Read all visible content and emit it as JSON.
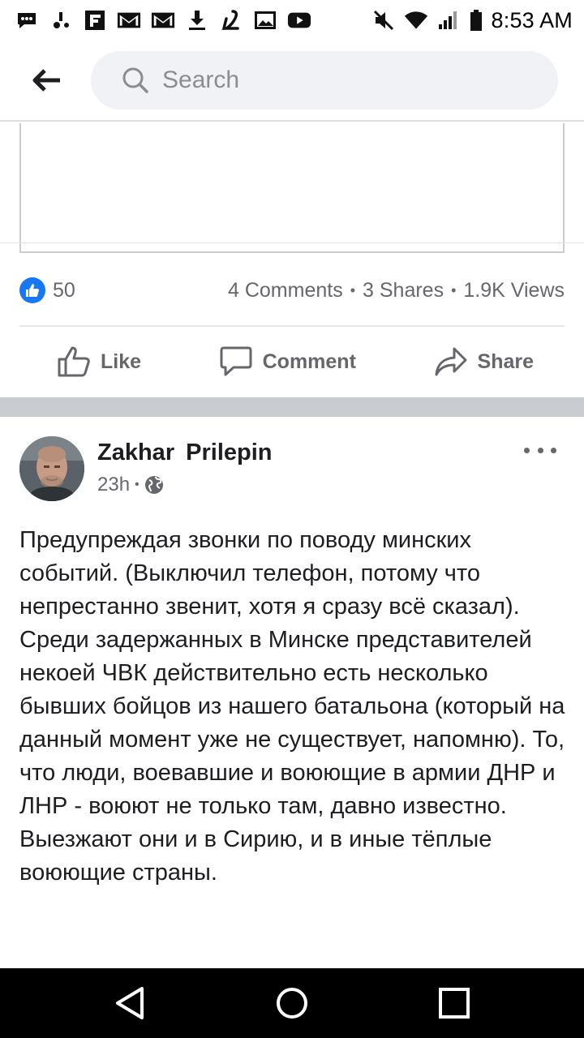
{
  "status_bar": {
    "time": "8:53 AM",
    "icons": [
      "messenger-icon",
      "voicemail-icon",
      "flipboard-icon",
      "gmail-icon",
      "gmail-icon",
      "download-icon",
      "lyft-icon",
      "image-icon",
      "youtube-icon",
      "mute-icon",
      "wifi-icon",
      "signal-icon",
      "battery-icon"
    ]
  },
  "search": {
    "placeholder": "Search"
  },
  "previous_post": {
    "like_count": "50",
    "comments": "4 Comments",
    "shares": "3 Shares",
    "views": "1.9K Views",
    "separator": "•"
  },
  "actions": {
    "like": "Like",
    "comment": "Comment",
    "share": "Share"
  },
  "post": {
    "author": "Zakhar  Prilepin",
    "time": "23h",
    "separator": "•",
    "audience_icon": "globe-icon",
    "text": "Предупреждая звонки по поводу минских событий. (Выключил телефон, потому что непрестанно звенит, хотя я сразу всё сказал).\nСреди задержанных в Минске представителей некоей ЧВК действительно есть несколько бывших бойцов из нашего батальона (который на данный момент уже не существует, напомню). То, что люди, воевавшие и воюющие в армии ДНР и ЛНР - воюют не только там, давно известно. Выезжают они и в Сирию, и в иные тёплые воюющие страны."
  },
  "nav": {
    "buttons": [
      "back-triangle-icon",
      "home-circle-icon",
      "recents-square-icon"
    ]
  },
  "colors": {
    "accent": "#1877f2",
    "secondary_text": "#65676b",
    "separator": "#c9ccd1"
  }
}
